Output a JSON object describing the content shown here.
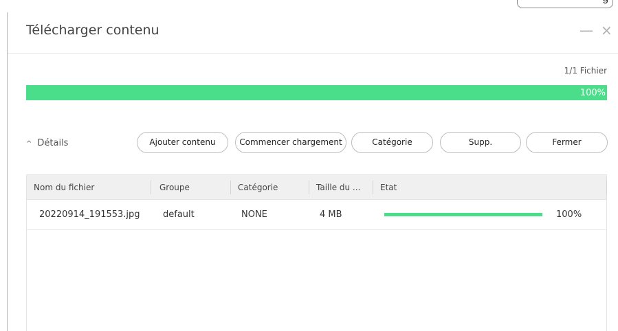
{
  "background": {
    "pill_text": "g"
  },
  "dialog": {
    "title": "Télécharger contenu",
    "minimize_glyph": "—",
    "close_glyph": "×"
  },
  "progress": {
    "file_count": "1/1 Fichier",
    "percent_label": "100%",
    "value": 1.0,
    "color": "#4ade8a"
  },
  "details": {
    "caret": "^",
    "label": "Détails"
  },
  "buttons": {
    "add": "Ajouter contenu",
    "start": "Commencer chargement",
    "category": "Catégorie",
    "delete": "Supp.",
    "close": "Fermer"
  },
  "table": {
    "columns": [
      "Nom du fichier",
      "Groupe",
      "Catégorie",
      "Taille du ...",
      "Etat"
    ],
    "rows": [
      {
        "filename": "20220914_191553.jpg",
        "group": "default",
        "category": "NONE",
        "size": "4 MB",
        "progress": 1.0,
        "status_percent": "100%"
      }
    ]
  }
}
